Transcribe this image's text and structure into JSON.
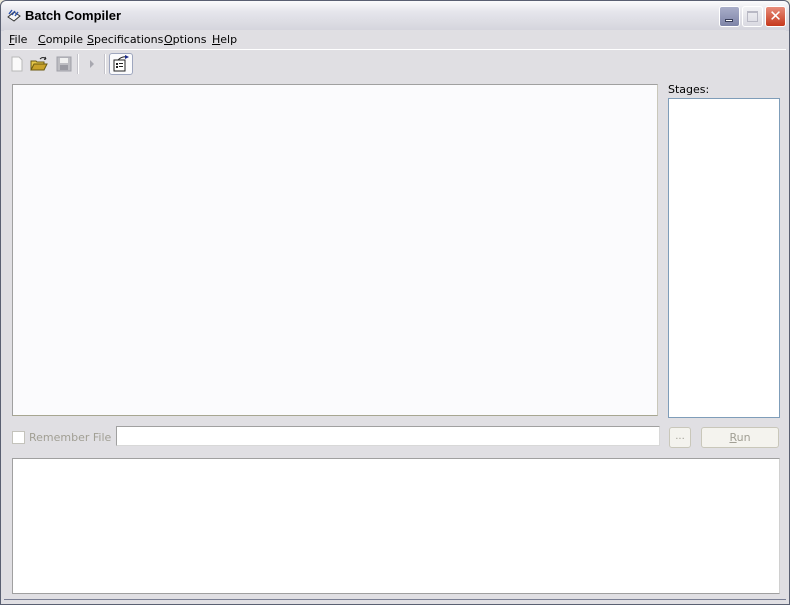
{
  "window": {
    "title": "Batch Compiler",
    "app_icon": "batch-compiler-icon",
    "controls": {
      "minimize_icon": "minimize-icon",
      "maximize_icon": "maximize-icon",
      "close_icon": "close-icon",
      "close_glyph": "✕"
    }
  },
  "menubar": {
    "items": [
      {
        "label_first": "F",
        "label_rest": "ile"
      },
      {
        "label_first": "C",
        "label_rest": "ompile"
      },
      {
        "label_first": "S",
        "label_rest": "pecifications"
      },
      {
        "label_first": "O",
        "label_rest": "ptions"
      },
      {
        "label_first": "H",
        "label_rest": "elp"
      }
    ]
  },
  "toolbar": {
    "items": [
      {
        "icon": "new-file-icon",
        "enabled": false
      },
      {
        "icon": "open-folder-icon",
        "enabled": true
      },
      {
        "icon": "save-icon",
        "enabled": false
      },
      {
        "icon": "run-arrow-icon",
        "enabled": false
      },
      {
        "icon": "specification-properties-icon",
        "enabled": true,
        "pressed": true
      }
    ]
  },
  "stages": {
    "label": "Stages:",
    "items": []
  },
  "file_row": {
    "remember_label": "Remember File",
    "remember_checked": false,
    "file_value": "",
    "browse_label": "...",
    "run_label_first": "R",
    "run_label_rest": "un"
  },
  "output": {
    "text": ""
  }
}
